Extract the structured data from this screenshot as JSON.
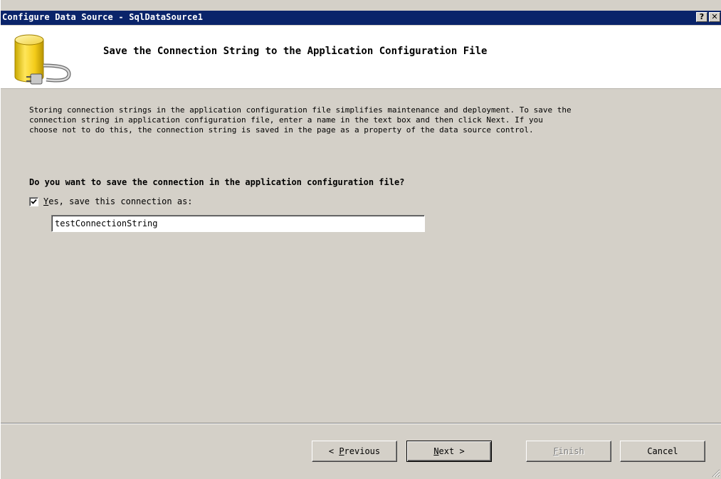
{
  "window": {
    "title": "Configure Data Source - SqlDataSource1",
    "help_glyph": "?",
    "close_glyph": "✕"
  },
  "header": {
    "title": "Save the Connection String to the Application Configuration File",
    "icon": "database-connection-icon"
  },
  "description": "Storing connection strings in the application configuration file simplifies maintenance and deployment. To save the\nconnection string in application configuration file, enter a name in the text box and then click Next. If you\nchoose not to do this, the connection string is saved in the page as a property of the data source control.",
  "question": "Do you want to save the connection in the application configuration file?",
  "save_option": {
    "checked": true,
    "label_mnemonic": "Y",
    "label_rest": "es, save this connection as:",
    "connection_name": "testConnectionString"
  },
  "buttons": {
    "previous_prefix": "< ",
    "previous_mnemonic": "P",
    "previous_rest": "revious",
    "next_mnemonic": "N",
    "next_rest": "ext >",
    "finish_mnemonic": "F",
    "finish_rest": "inish",
    "cancel": "Cancel"
  },
  "colors": {
    "titlebar": "#0a246a",
    "dialog_face": "#d4d0c8",
    "header_bg": "#ffffff"
  }
}
